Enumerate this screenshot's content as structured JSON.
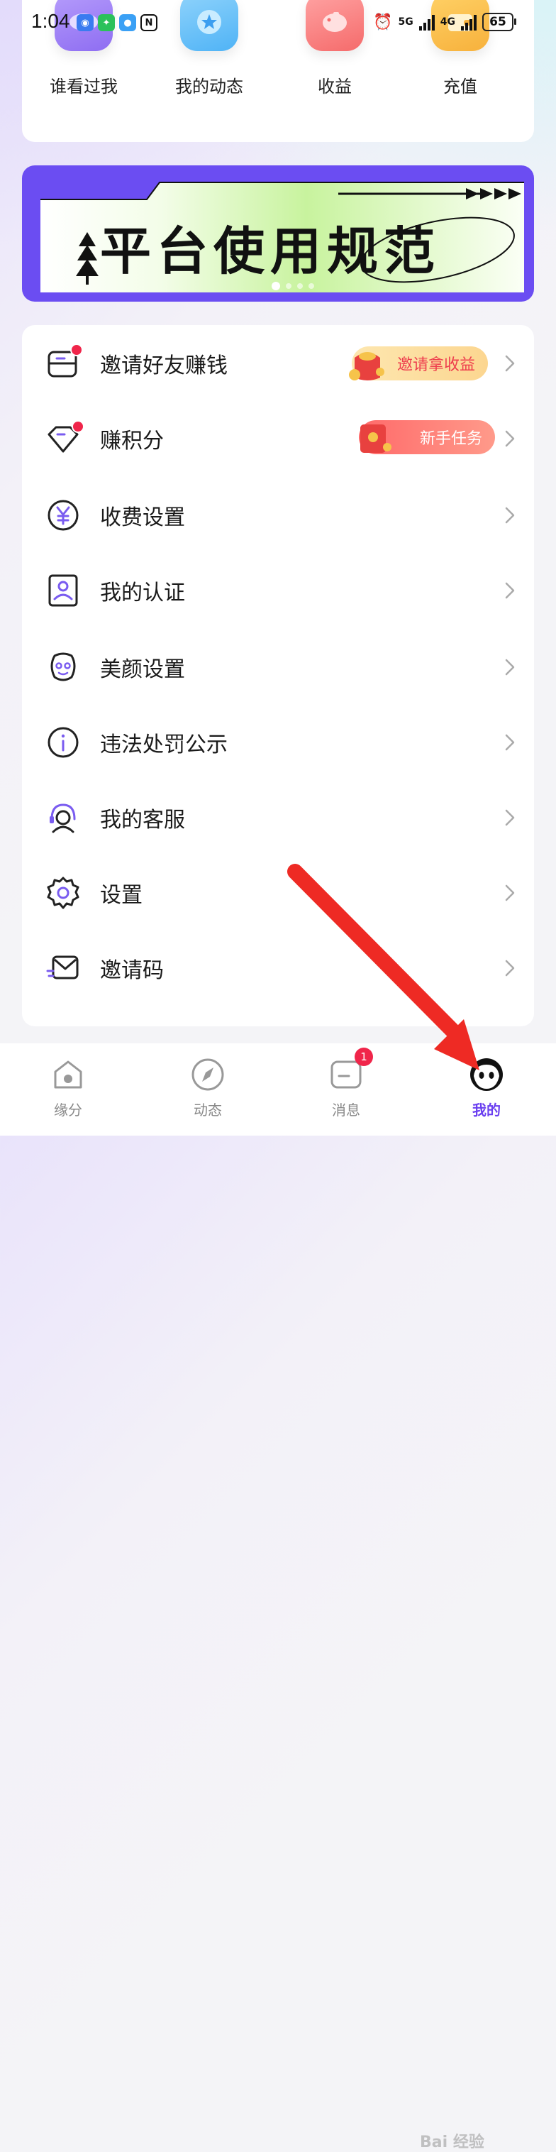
{
  "status_bar": {
    "time": "1:04",
    "battery": "65",
    "net1": "5G",
    "net2": "4G"
  },
  "quick_actions": [
    {
      "label": "谁看过我",
      "icon": "eye-icon",
      "color": "#9b7cf6"
    },
    {
      "label": "我的动态",
      "icon": "star-icon",
      "color": "#4fb3f6"
    },
    {
      "label": "收益",
      "icon": "piggy-bank-icon",
      "color": "#f56b6b"
    },
    {
      "label": "充值",
      "icon": "wallet-icon",
      "color": "#f7b13c"
    }
  ],
  "banner": {
    "title": "平台使用规范",
    "accent": "#6b4df2"
  },
  "menu": [
    {
      "label": "邀请好友赚钱",
      "icon": "invite-envelope-icon",
      "pill": "邀请拿收益"
    },
    {
      "label": "赚积分",
      "icon": "diamond-icon",
      "pill": "新手任务"
    },
    {
      "label": "收费设置",
      "icon": "yen-icon"
    },
    {
      "label": "我的认证",
      "icon": "id-card-icon"
    },
    {
      "label": "美颜设置",
      "icon": "face-icon"
    },
    {
      "label": "违法处罚公示",
      "icon": "info-icon"
    },
    {
      "label": "我的客服",
      "icon": "headset-icon"
    },
    {
      "label": "设置",
      "icon": "gear-icon"
    },
    {
      "label": "邀请码",
      "icon": "mail-icon"
    }
  ],
  "tabs": [
    {
      "label": "缘分",
      "icon": "home-icon"
    },
    {
      "label": "动态",
      "icon": "compass-icon"
    },
    {
      "label": "消息",
      "icon": "message-icon",
      "badge": "1"
    },
    {
      "label": "我的",
      "icon": "profile-face-icon",
      "active": true
    }
  ],
  "watermark": "Bai 经验"
}
